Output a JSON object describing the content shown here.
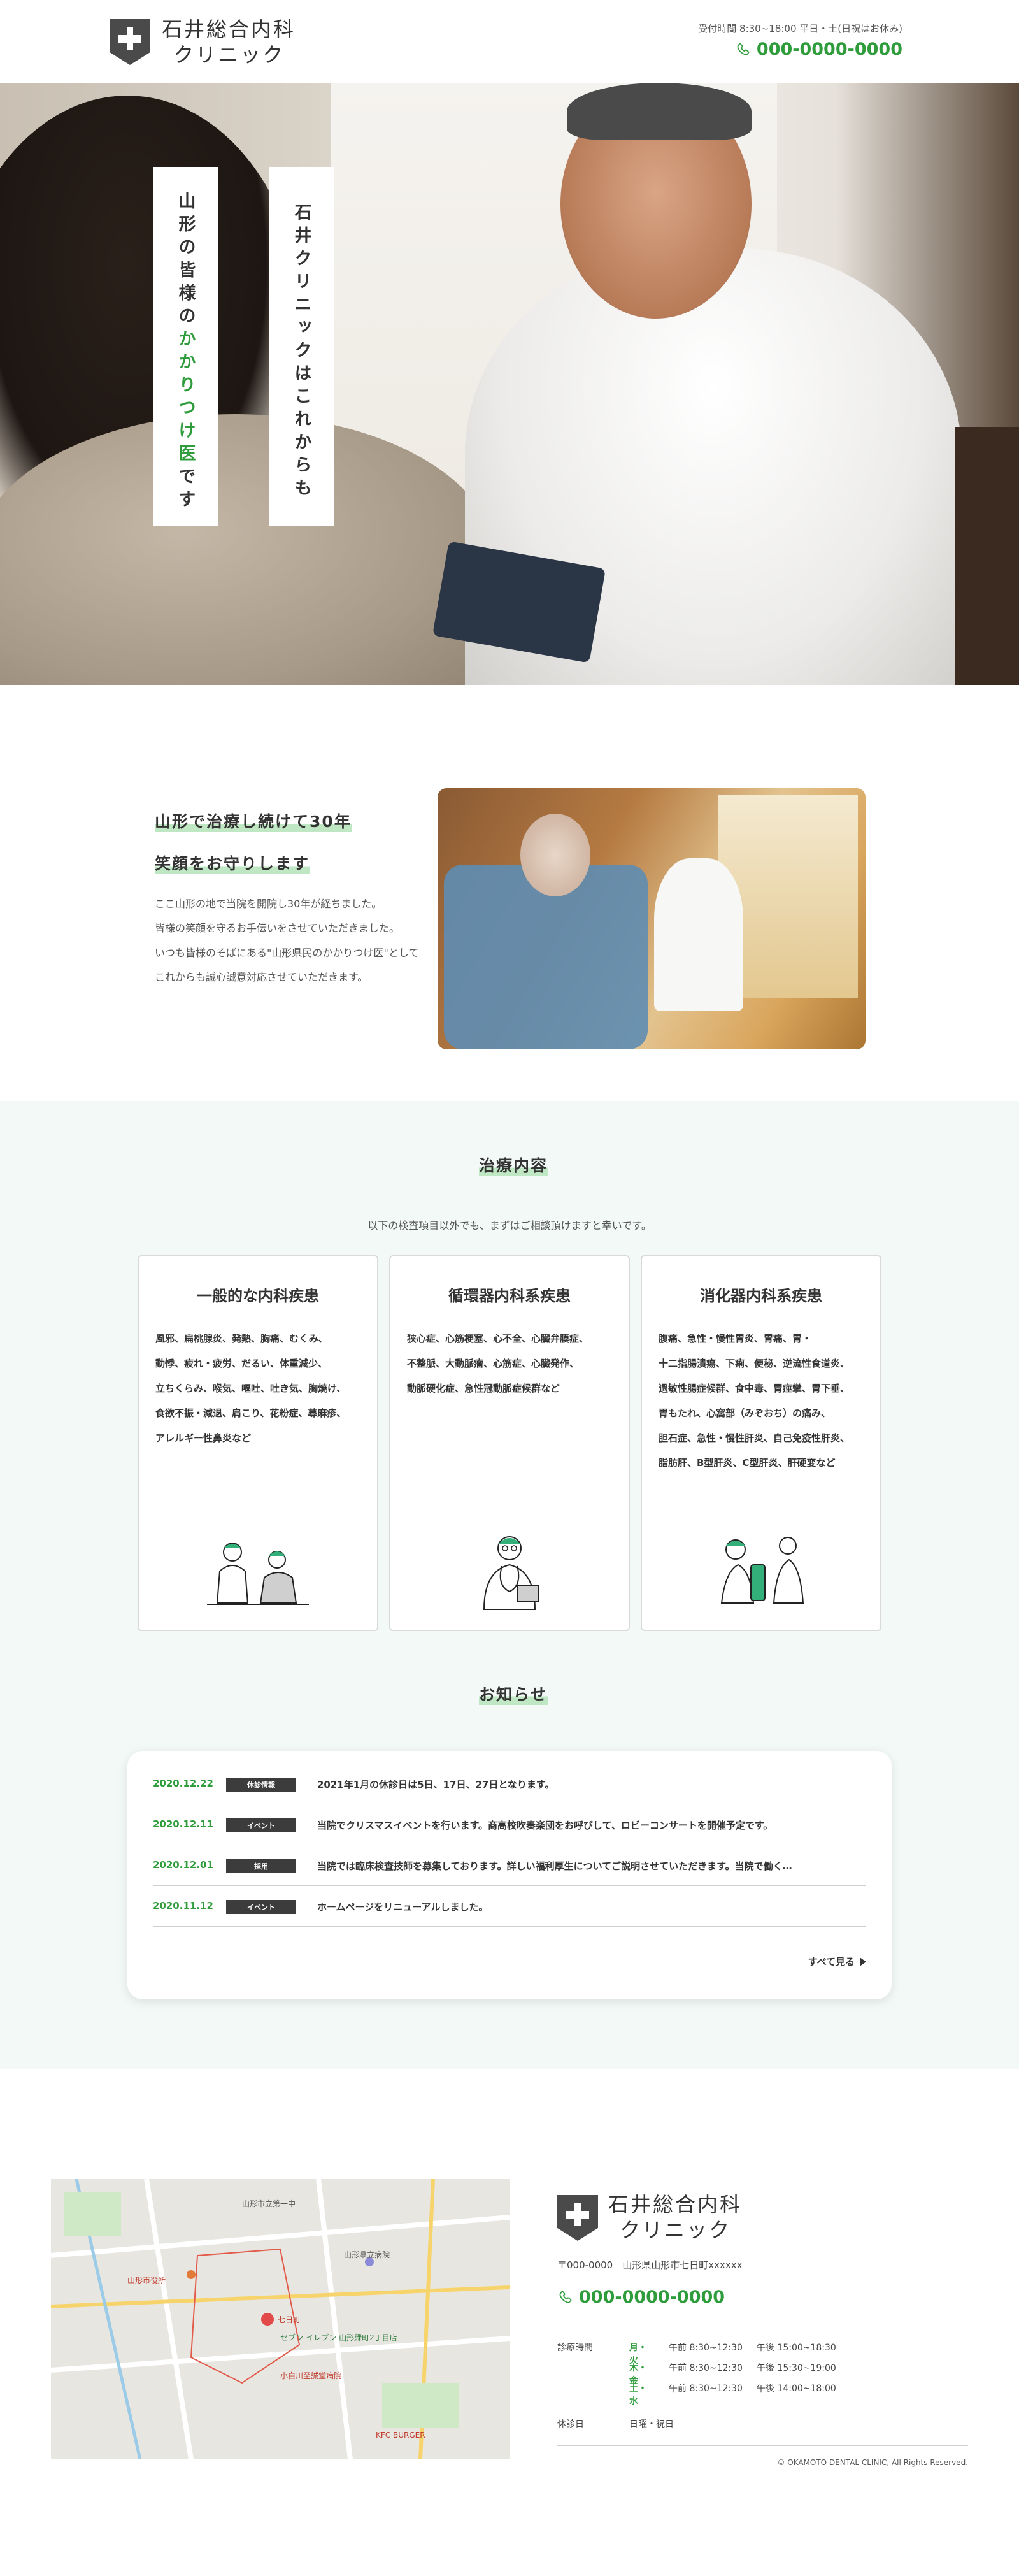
{
  "header": {
    "clinic_name_line1": "石井総合内科",
    "clinic_name_line2": "クリニック",
    "hours": "受付時間 8:30~18:00 平日・土(日祝はお休み)",
    "phone": "000-0000-0000"
  },
  "hero": {
    "copy_right": "石井クリニックはこれからも",
    "copy_left_prefix": "山形の皆様の",
    "copy_left_accent": "かかりつけ医",
    "copy_left_suffix": "です"
  },
  "intro": {
    "title_line1": "山形で治療し続けて30年",
    "title_line2": "笑顔をお守りします",
    "paragraph": [
      "ここ山形の地で当院を開院し30年が経ちました。",
      "皆様の笑顔を守るお手伝いをさせていただきました。",
      "いつも皆様のそばにある\"山形県民のかかりつけ医\"として",
      "これからも誠心誠意対応させていただきます。"
    ]
  },
  "treatment": {
    "title": "治療内容",
    "lead": "以下の検査項目以外でも、まずはご相談頂けますと幸いです。",
    "cards": [
      {
        "title": "一般的な内科疾患",
        "lines": [
          "風邪、扁桃腺炎、発熱、胸痛、むくみ、",
          "動悸、疲れ・疲労、だるい、体重減少、",
          "立ちくらみ、喉気、嘔吐、吐き気、胸焼け、",
          "食欲不振・減退、肩こり、花粉症、蕁麻疹、",
          "アレルギー性鼻炎など"
        ],
        "illustration": "doctor-and-patient-illustration"
      },
      {
        "title": "循環器内科系疾患",
        "lines": [
          "狭心症、心筋梗塞、心不全、心臓弁膜症、",
          "不整脈、大動脈瘤、心筋症、心臓発作、",
          "動脈硬化症、急性冠動脈症候群など"
        ],
        "illustration": "doctor-with-stethoscope-illustration"
      },
      {
        "title": "消化器内科系疾患",
        "lines": [
          "腹痛、急性・慢性胃炎、胃痛、胃・",
          "十二指腸潰瘍、下痢、便秘、逆流性食道炎、",
          "過敏性腸症候群、食中毒、胃痙攣、胃下垂、",
          "胃もたれ、心窩部（みぞおち）の痛み、",
          "胆石症、急性・慢性肝炎、自己免疫性肝炎、",
          "脂肪肝、B型肝炎、C型肝炎、肝硬変など"
        ],
        "illustration": "blood-pressure-check-illustration"
      }
    ]
  },
  "news": {
    "title": "お知らせ",
    "items": [
      {
        "date": "2020.12.22",
        "category": "休診情報",
        "text": "2021年1月の休診日は5日、17日、27日となります。"
      },
      {
        "date": "2020.12.11",
        "category": "イベント",
        "text": "当院でクリスマスイベントを行います。商高校吹奏楽団をお呼びして、ロビーコンサートを開催予定です。"
      },
      {
        "date": "2020.12.01",
        "category": "採用",
        "text": "当院では臨床検査技師を募集しております。詳しい福利厚生についてご説明させていただきます。当院で働く…"
      },
      {
        "date": "2020.11.12",
        "category": "イベント",
        "text": "ホームページをリニューアルしました。"
      }
    ],
    "more": "すべて見る"
  },
  "footer": {
    "clinic_name_line1": "石井総合内科",
    "clinic_name_line2": "クリニック",
    "address": "〒000-0000　山形県山形市七日町xxxxxx",
    "phone": "000-0000-0000",
    "schedule_label": "診療時間",
    "schedule": [
      {
        "days": "月・火",
        "am": "午前 8:30~12:30",
        "pm": "午後 15:00~18:30"
      },
      {
        "days": "木・金",
        "am": "午前 8:30~12:30",
        "pm": "午後 15:30~19:00"
      },
      {
        "days": "土・水",
        "am": "午前 8:30~12:30",
        "pm": "午後 14:00~18:00"
      }
    ],
    "holiday_label": "休診日",
    "holiday": "日曜・祝日",
    "copyright": "© OKAMOTO DENTAL CLINIC, All Rights Reserved.",
    "map_labels": [
      "山形市立第一中",
      "七日町",
      "山形市役所",
      "小白川至誠堂病院",
      "セブン-イレブン 山形緑町2丁目店",
      "山形県立病院",
      "KFC BURGER"
    ]
  },
  "colors": {
    "accent": "#2f9c3c",
    "highlight": "#bfe7c4",
    "section_bg": "#f2f9f6",
    "dark": "#3c3c3c"
  }
}
